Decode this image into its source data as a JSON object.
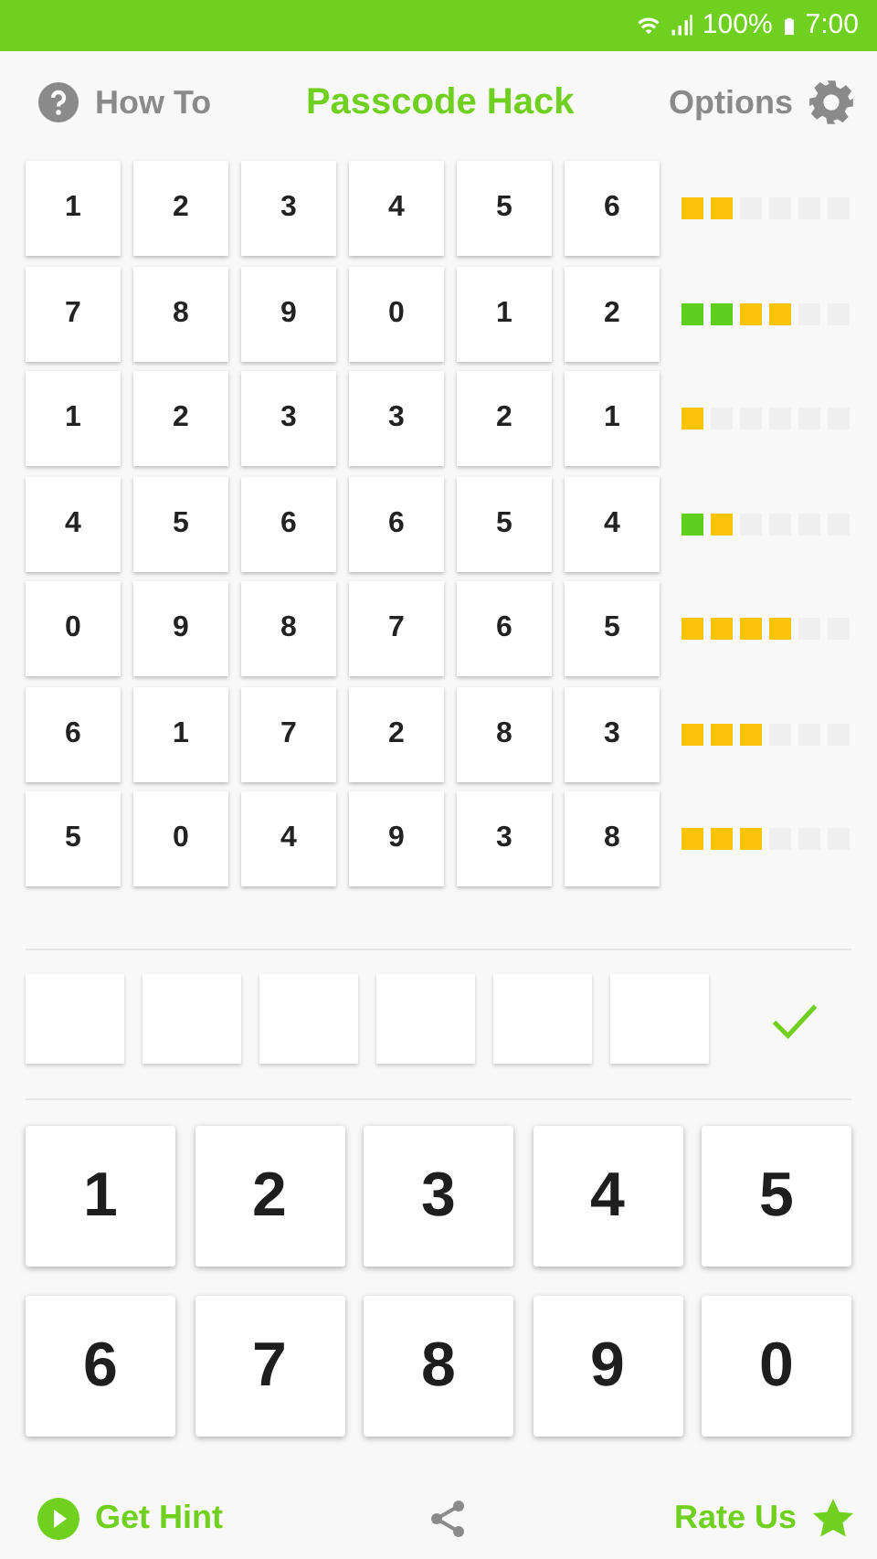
{
  "status_bar": {
    "battery": "100%",
    "time": "7:00"
  },
  "header": {
    "left": "How To",
    "title": "Passcode Hack",
    "right": "Options"
  },
  "guesses": [
    {
      "digits": [
        "1",
        "2",
        "3",
        "4",
        "5",
        "6"
      ],
      "pegs": [
        {
          "kind": "present"
        },
        {
          "kind": "present"
        },
        {
          "kind": "none"
        },
        {
          "kind": "none"
        },
        {
          "kind": "none"
        },
        {
          "kind": "none"
        }
      ]
    },
    {
      "digits": [
        "7",
        "8",
        "9",
        "0",
        "1",
        "2"
      ],
      "pegs": [
        {
          "kind": "exact"
        },
        {
          "kind": "exact"
        },
        {
          "kind": "present"
        },
        {
          "kind": "present"
        },
        {
          "kind": "none"
        },
        {
          "kind": "none"
        }
      ]
    },
    {
      "digits": [
        "1",
        "2",
        "3",
        "3",
        "2",
        "1"
      ],
      "pegs": [
        {
          "kind": "present"
        },
        {
          "kind": "none"
        },
        {
          "kind": "none"
        },
        {
          "kind": "none"
        },
        {
          "kind": "none"
        },
        {
          "kind": "none"
        }
      ]
    },
    {
      "digits": [
        "4",
        "5",
        "6",
        "6",
        "5",
        "4"
      ],
      "pegs": [
        {
          "kind": "exact"
        },
        {
          "kind": "present"
        },
        {
          "kind": "none"
        },
        {
          "kind": "none"
        },
        {
          "kind": "none"
        },
        {
          "kind": "none"
        }
      ]
    },
    {
      "digits": [
        "0",
        "9",
        "8",
        "7",
        "6",
        "5"
      ],
      "pegs": [
        {
          "kind": "present"
        },
        {
          "kind": "present"
        },
        {
          "kind": "present"
        },
        {
          "kind": "present"
        },
        {
          "kind": "none"
        },
        {
          "kind": "none"
        }
      ]
    },
    {
      "digits": [
        "6",
        "1",
        "7",
        "2",
        "8",
        "3"
      ],
      "pegs": [
        {
          "kind": "present"
        },
        {
          "kind": "present"
        },
        {
          "kind": "present"
        },
        {
          "kind": "none"
        },
        {
          "kind": "none"
        },
        {
          "kind": "none"
        }
      ]
    },
    {
      "digits": [
        "5",
        "0",
        "4",
        "9",
        "3",
        "8"
      ],
      "pegs": [
        {
          "kind": "present"
        },
        {
          "kind": "present"
        },
        {
          "kind": "present"
        },
        {
          "kind": "none"
        },
        {
          "kind": "none"
        },
        {
          "kind": "none"
        }
      ]
    }
  ],
  "entry_slots": [
    {
      "filled": false
    },
    {
      "filled": false
    },
    {
      "filled": false
    },
    {
      "filled": false
    },
    {
      "filled": false
    },
    {
      "filled": false
    }
  ],
  "keypad": [
    [
      "1",
      "2",
      "3",
      "4",
      "5"
    ],
    [
      "6",
      "7",
      "8",
      "9",
      "0"
    ]
  ],
  "footer": {
    "hint": "Get Hint",
    "rate": "Rate Us"
  }
}
